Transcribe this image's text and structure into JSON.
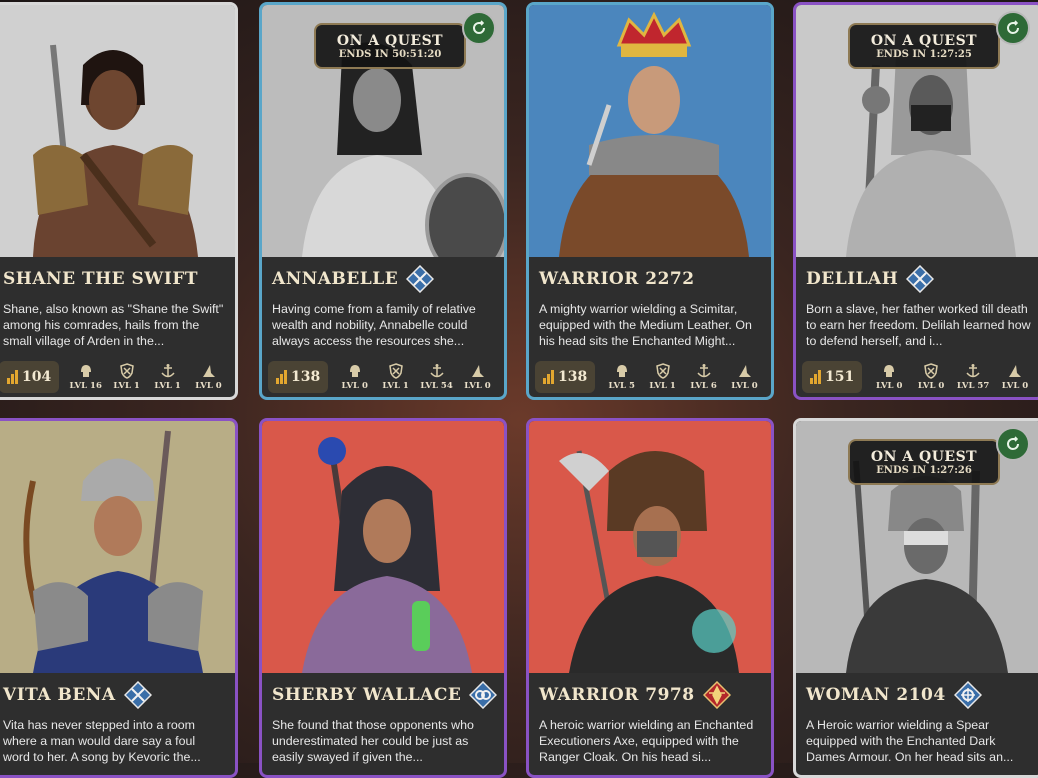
{
  "cards": [
    {
      "name": "Shane the Swift",
      "desc": "Shane, also known as \"Shane the Swift\" among his comrades, hails from the small village of Arden in the...",
      "power": "104",
      "levels": [
        "LVL 16",
        "LVL 1",
        "LVL 1",
        "LVL 0"
      ],
      "border": "#d8d8d8",
      "art_bg": "#cfcfcf",
      "cls_icon": "none"
    },
    {
      "name": "Annabelle",
      "desc": "Having come from a family of relative wealth and nobility, Annabelle could always access the resources she...",
      "power": "138",
      "levels": [
        "LVL 0",
        "LVL 1",
        "LVL 54",
        "LVL 0"
      ],
      "border": "#5aa6c9",
      "art_bg": "#bdbdbd",
      "cls_icon": "rogue-class-icon",
      "quest": {
        "title": "ON A QUEST",
        "ends": "ENDS IN 50:51:20"
      }
    },
    {
      "name": "Warrior 2272",
      "desc": "A mighty warrior wielding a Scimitar, equipped with the Medium Leather. On his head sits the Enchanted Might...",
      "power": "138",
      "levels": [
        "LVL 5",
        "LVL 1",
        "LVL 6",
        "LVL 0"
      ],
      "border": "#5aa6c9",
      "art_bg": "#4b86bd",
      "cls_icon": "none"
    },
    {
      "name": "Delilah",
      "desc": "Born a slave, her father worked till death to earn her freedom. Delilah learned how to defend herself, and i...",
      "power": "151",
      "levels": [
        "LVL 0",
        "LVL 0",
        "LVL 57",
        "LVL 0"
      ],
      "border": "#8a52c4",
      "art_bg": "#c9c9c9",
      "cls_icon": "rogue-class-icon",
      "quest": {
        "title": "ON A QUEST",
        "ends": "ENDS IN 1:27:25"
      }
    },
    {
      "name": "Vita Bena",
      "desc": "Vita has never stepped into a room where a man would dare say a foul word to her. A song by Kevoric the...",
      "power": "",
      "levels": [],
      "border": "#8a52c4",
      "art_bg": "#b8ad86",
      "cls_icon": "rogue-class-icon"
    },
    {
      "name": "Sherby Wallace",
      "desc": "She found that those opponents who underestimated her could be just as easily swayed if given the...",
      "power": "",
      "levels": [],
      "border": "#8a52c4",
      "art_bg": "#d9584a",
      "cls_icon": "mage-class-icon"
    },
    {
      "name": "Warrior 7978",
      "desc": "A heroic warrior wielding an Enchanted Executioners Axe, equipped with the Ranger Cloak. On his head si...",
      "power": "",
      "levels": [],
      "border": "#8a52c4",
      "art_bg": "#d9584a",
      "cls_icon": "warrior-class-icon"
    },
    {
      "name": "Woman 2104",
      "desc": "A Heroic warrior wielding a Spear equipped with the Enchanted Dark Dames Armour. On her head sits an...",
      "power": "",
      "levels": [],
      "border": "#d8d8d8",
      "art_bg": "#b8b8b8",
      "cls_icon": "mage-wheel-class-icon",
      "quest": {
        "title": "ON A QUEST",
        "ends": "ENDS IN 1:27:26"
      }
    }
  ],
  "skill_icons": [
    "combat-helm-icon",
    "shield-icon",
    "anchor-icon",
    "wizard-hat-icon"
  ],
  "colors": {
    "accent_gold": "#e3a72f",
    "title_text": "#f1e6cc"
  }
}
